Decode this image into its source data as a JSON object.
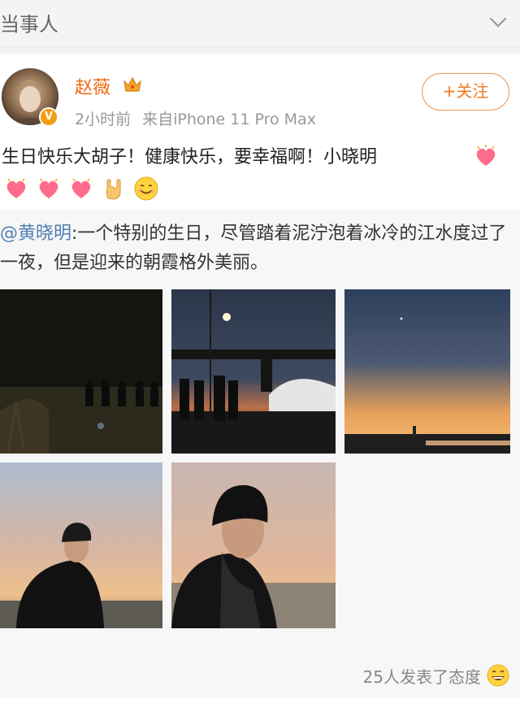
{
  "header": {
    "title": "当事人",
    "chevron_icon": "chevron-down-icon"
  },
  "post": {
    "author": "赵薇",
    "badge_icon": "crown-icon",
    "verified_mark": "V",
    "time": "2小时前",
    "source": "来自iPhone 11 Pro Max",
    "follow_label": "+关注",
    "text": "生日快乐大胡子！健康快乐，要幸福啊！小晓明",
    "emojis": [
      "heart-icon",
      "heart-icon",
      "heart-icon",
      "rock-hand-icon",
      "smile-icon"
    ]
  },
  "repost": {
    "mention": "@黄晓明",
    "text": ":一个特别的生日，尽管踏着泥泞泡着冰冷的江水度过了一夜，但是迎来的朝霞格外美丽。",
    "photos": [
      "night-crowd-photo",
      "bridge-night-photo",
      "sunset-river-photo",
      "man-portrait-photo",
      "man-closeup-photo"
    ]
  },
  "reactions": {
    "count_text": "25人发表了态度",
    "icon": "grin-icon"
  },
  "colors": {
    "orange": "#f06a16",
    "link": "#4f7fb3",
    "meta": "#999999"
  }
}
